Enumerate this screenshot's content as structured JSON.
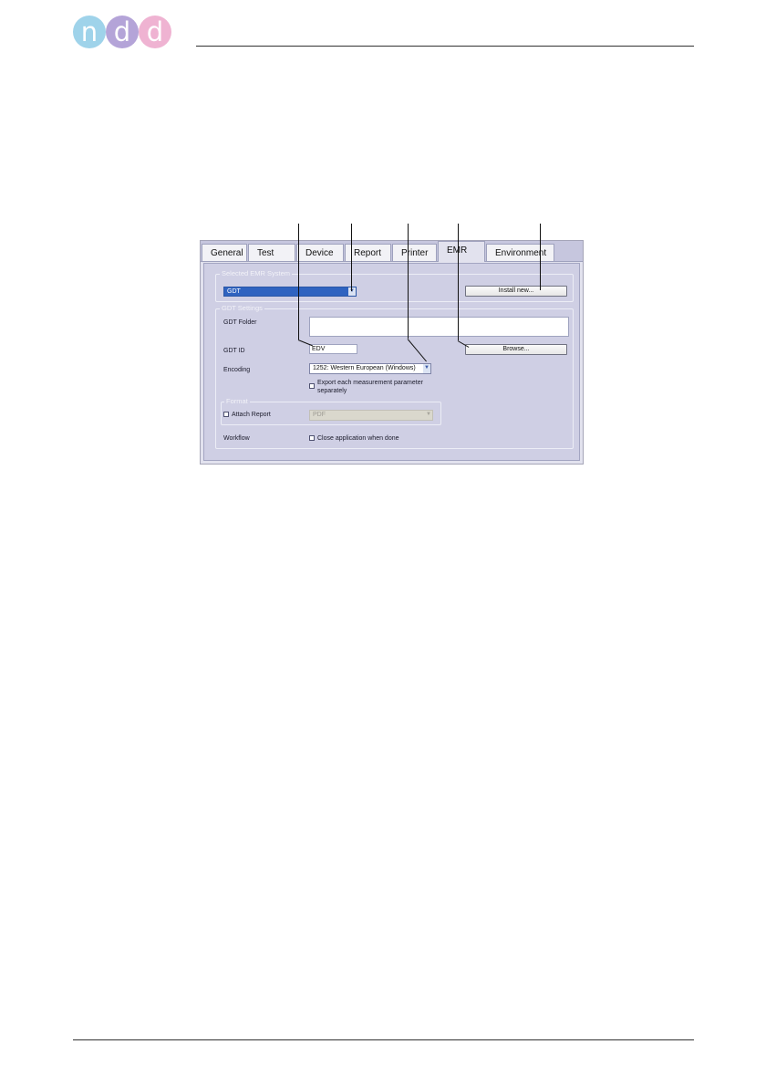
{
  "logo": {
    "letters": [
      "n",
      "d",
      "d"
    ],
    "colors": [
      "#9fd3ea",
      "#b4a4d8",
      "#efb3d2"
    ]
  },
  "tabs": [
    {
      "label": "General",
      "active": false
    },
    {
      "label": "Test",
      "active": false
    },
    {
      "label": "Device",
      "active": false
    },
    {
      "label": "Report",
      "active": false
    },
    {
      "label": "Printer",
      "active": false
    },
    {
      "label": "EMR",
      "active": true
    },
    {
      "label": "Environment",
      "active": false
    }
  ],
  "selected_emr": {
    "group_title": "Selected EMR System",
    "value": "GDT",
    "install_button": "Install new..."
  },
  "gdt_settings": {
    "group_title": "GDT Settings",
    "folder_label": "GDT Folder",
    "folder_value": "",
    "id_label": "GDT ID",
    "id_value": "EDV",
    "browse_button": "Browse...",
    "encoding_label": "Encoding",
    "encoding_value": "1252: Western European (Windows)",
    "export_checkbox_line1": "Export each measurement parameter",
    "export_checkbox_line2": "separately",
    "format_group_title": "Format",
    "attach_report_label": "Attach Report",
    "attach_report_format": "PDF",
    "workflow_label": "Workflow",
    "close_app_label": "Close application when done"
  },
  "colors": {
    "tab_strip": "#c6c6de",
    "panel": "#cfcfe4",
    "selection_blue": "#2f63c0"
  }
}
